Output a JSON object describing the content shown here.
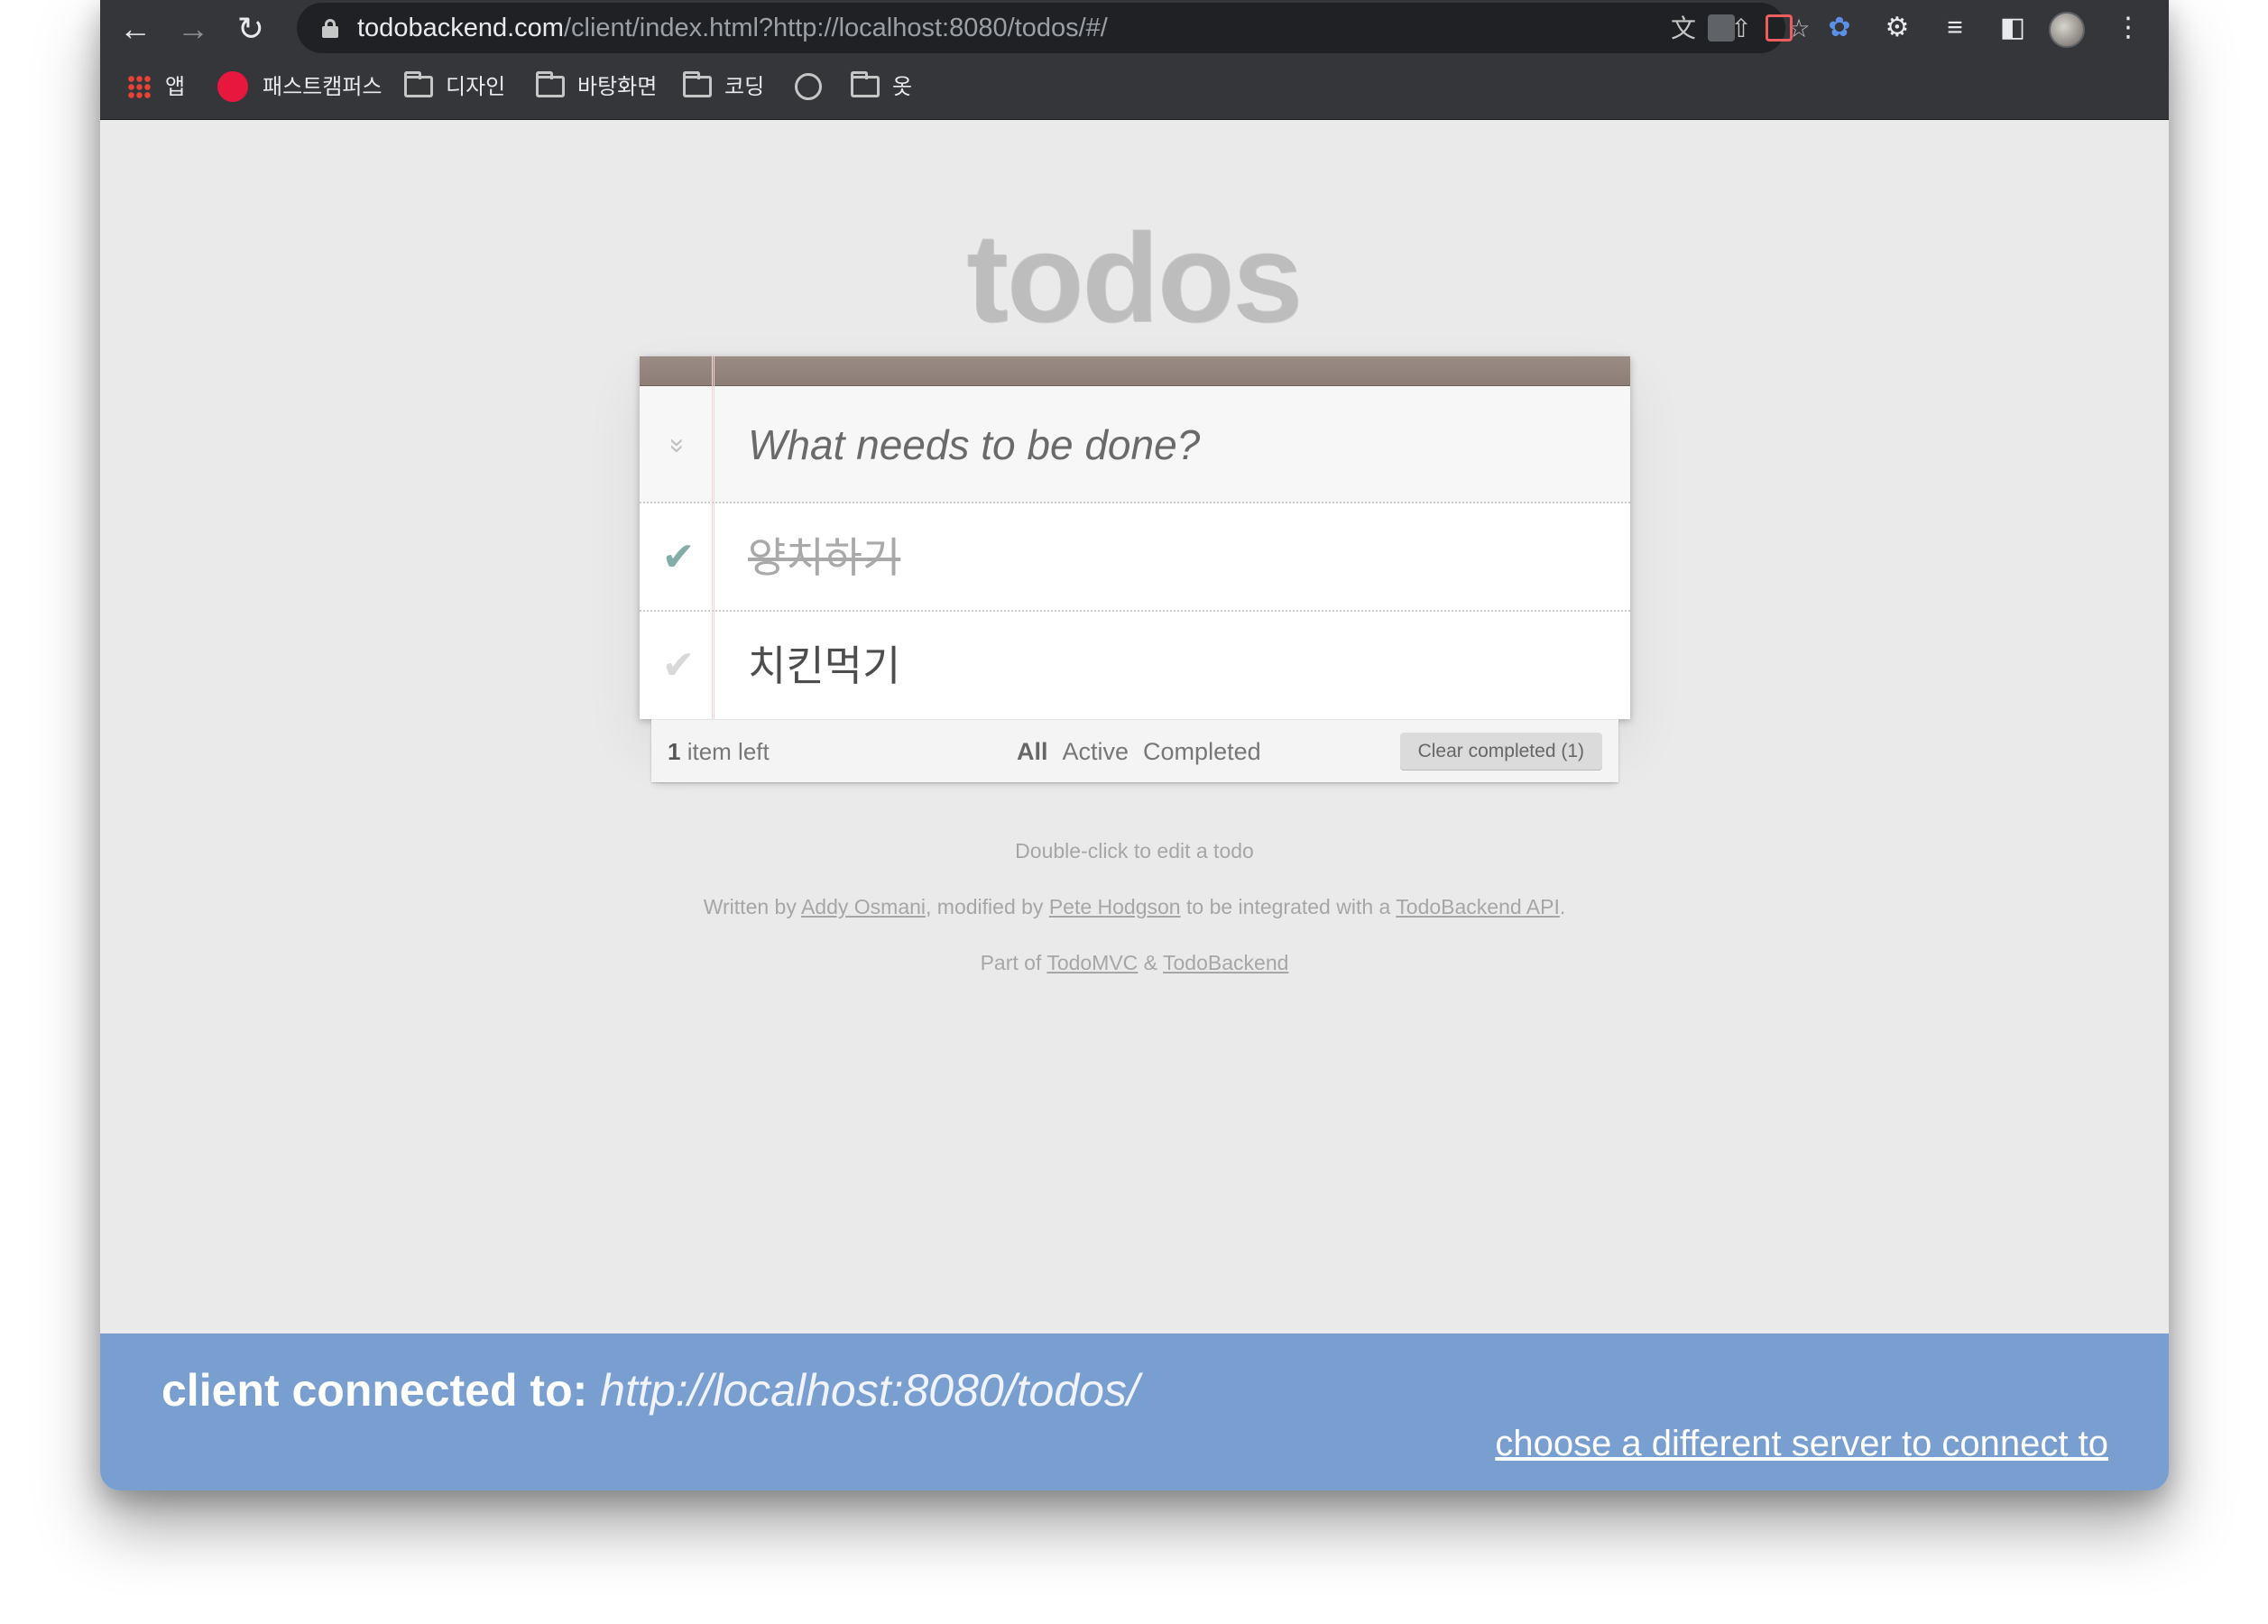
{
  "browser": {
    "url_host": "todobackend.com",
    "url_path": "/client/index.html?http://localhost:8080/todos/#/",
    "bookmarks": [
      {
        "label": "앱",
        "icon": "apps-grid-icon"
      },
      {
        "label": "패스트캠퍼스",
        "icon": "fastcampus-logo-icon"
      },
      {
        "label": "디자인",
        "icon": "folder-icon"
      },
      {
        "label": "바탕화면",
        "icon": "folder-icon"
      },
      {
        "label": "코딩",
        "icon": "folder-icon"
      },
      {
        "label": "",
        "icon": "globe-icon"
      },
      {
        "label": "옷",
        "icon": "folder-icon"
      }
    ]
  },
  "app": {
    "title": "todos",
    "new_todo_placeholder": "What needs to be done?",
    "todos": [
      {
        "title": "양치하기",
        "completed": true
      },
      {
        "title": "치킨먹기",
        "completed": false
      }
    ],
    "footer": {
      "count": "1",
      "count_suffix": "item left",
      "filters": [
        "All",
        "Active",
        "Completed"
      ],
      "selected_filter": "All",
      "clear_label": "Clear completed (1)"
    },
    "info": {
      "hint": "Double-click to edit a todo",
      "written_prefix": "Written by ",
      "author1": "Addy Osmani",
      "modified": ", modified by ",
      "author2": "Pete Hodgson",
      "integrated": " to be integrated with a ",
      "api": "TodoBackend API",
      "period": ".",
      "part_of": "Part of ",
      "todomvc": "TodoMVC",
      "amp": " & ",
      "todobackend": "TodoBackend"
    }
  },
  "banner": {
    "label": "client connected to:",
    "server": "http://localhost:8080/todos/",
    "change_link": "choose a different server to connect to",
    "color": "#789fd0"
  }
}
